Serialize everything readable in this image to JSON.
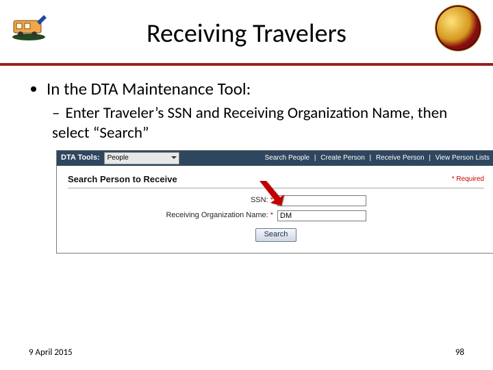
{
  "slide": {
    "title": "Receiving Travelers",
    "bullet1": "In the DTA Maintenance Tool:",
    "bullet2": "Enter Traveler’s SSN and Receiving Organization Name, then select “Search”",
    "footer_date": "9 April 2015",
    "page_number": "98"
  },
  "screenshot": {
    "toolbar_label": "DTA Tools:",
    "toolbar_select_value": "People",
    "link_search_people": "Search People",
    "link_create_person": "Create Person",
    "link_receive_person": "Receive Person",
    "link_view_person_lists": "View Person Lists",
    "section_title": "Search Person to Receive",
    "required_label": "Required",
    "field_ssn_label": "SSN:",
    "field_ssn_value": "",
    "field_org_label": "Receiving Organization Name:",
    "field_org_value": "DM",
    "search_button": "Search"
  },
  "icons": {
    "left_logo": "travel-logo-icon",
    "right_seal": "usmc-seal-icon",
    "arrow": "red-arrow-icon"
  }
}
